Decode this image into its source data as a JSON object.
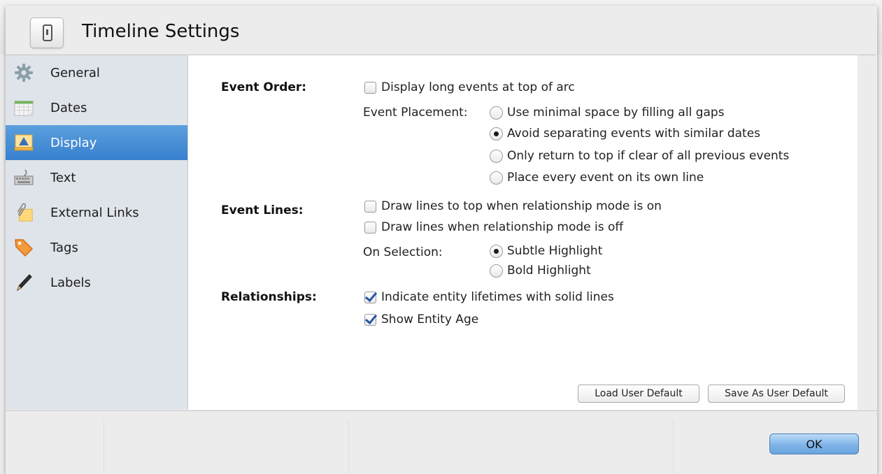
{
  "window": {
    "title": "Timeline Settings"
  },
  "sidebar": {
    "items": [
      {
        "label": "General",
        "icon": "gear-icon"
      },
      {
        "label": "Dates",
        "icon": "calendar-icon"
      },
      {
        "label": "Display",
        "icon": "display-icon",
        "selected": true
      },
      {
        "label": "Text",
        "icon": "keyboard-icon"
      },
      {
        "label": "External Links",
        "icon": "paperclip-icon"
      },
      {
        "label": "Tags",
        "icon": "tag-icon"
      },
      {
        "label": "Labels",
        "icon": "pencil-icon"
      }
    ]
  },
  "event_order": {
    "label": "Event Order:",
    "long_events": {
      "label": "Display long events at top of arc",
      "checked": false
    },
    "placement": {
      "label": "Event Placement:",
      "options": [
        {
          "label": "Use minimal space by filling all gaps",
          "selected": false
        },
        {
          "label": "Avoid separating events with similar dates",
          "selected": true
        },
        {
          "label": "Only return to top if clear of all previous events",
          "selected": false
        },
        {
          "label": "Place every event on its own line",
          "selected": false
        }
      ]
    }
  },
  "event_lines": {
    "label": "Event Lines:",
    "options": [
      {
        "label": "Draw lines to top when relationship mode is on",
        "checked": false
      },
      {
        "label": "Draw lines when relationship mode is off",
        "checked": false
      }
    ],
    "selection": {
      "label": "On Selection:",
      "options": [
        {
          "label": "Subtle Highlight",
          "selected": true
        },
        {
          "label": "Bold Highlight",
          "selected": false
        }
      ]
    }
  },
  "relationships": {
    "label": "Relationships:",
    "options": [
      {
        "label": "Indicate entity lifetimes with solid lines",
        "checked": true
      },
      {
        "label": "Show Entity Age",
        "checked": true
      }
    ]
  },
  "buttons": {
    "load_default": "Load User Default",
    "save_default": "Save As User Default",
    "ok": "OK"
  },
  "colors": {
    "selection": "#3f87d4",
    "ok_button": "#8cbcec"
  }
}
